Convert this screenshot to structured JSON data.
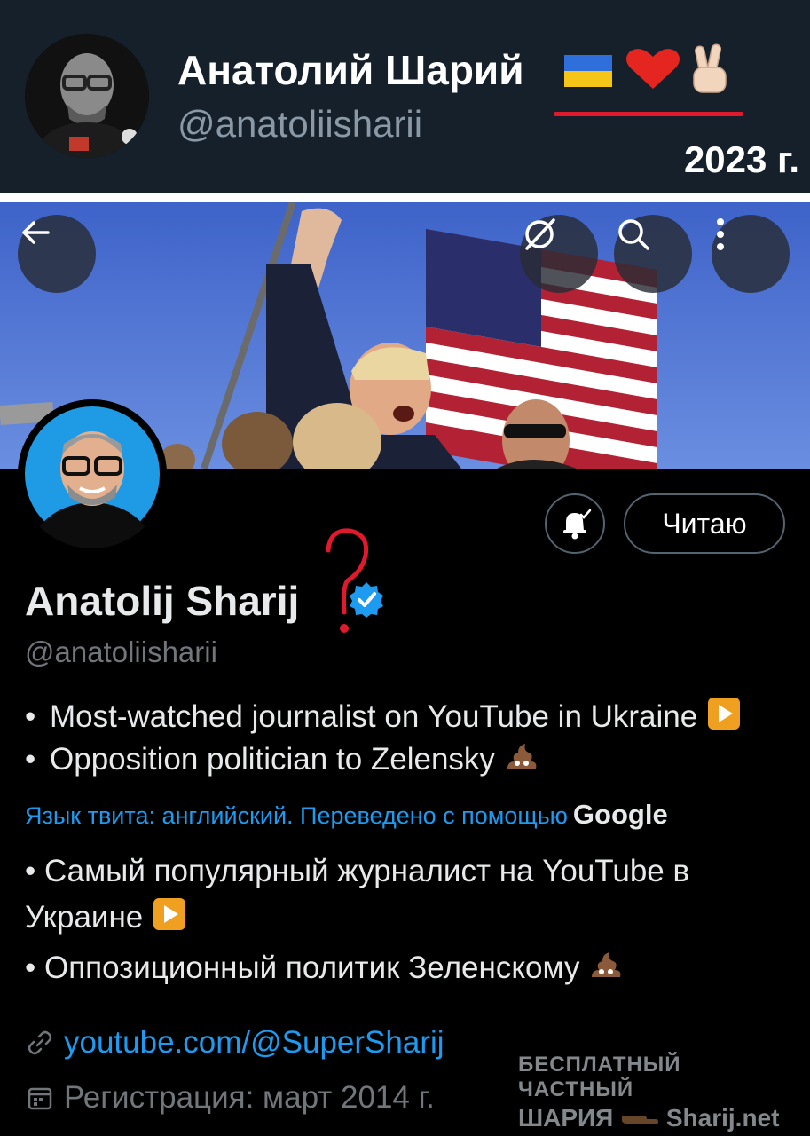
{
  "banner": {
    "name": "Анатолий Шарий",
    "handle": "@anatoliisharii",
    "year_label": "2023 г."
  },
  "header_buttons": [
    "back-arrow-icon",
    "grok-icon",
    "search-icon",
    "more-vertical-icon"
  ],
  "profile": {
    "display_name": "Anatolij Sharij",
    "handle": "@anatoliisharii",
    "follow_label": "Читаю",
    "bio": [
      "Most-watched journalist on YouTube in Ukraine",
      "Opposition politician to Zelensky"
    ],
    "translate_label": "Язык твита: английский. Переведено с помощью",
    "translate_brand": "Google",
    "translated_bio": [
      "• Самый популярный журналист на YouTube в Украине",
      "• Оппозиционный политик Зеленскому"
    ],
    "link": "youtube.com/@SuperSharij",
    "registration": "Регистрация: март 2014 г."
  },
  "watermark": {
    "line1": "БЕСПЛАТНЫЙ ЧАСТНЫЙ",
    "line2": "ШАРИЯ",
    "line2_site": "Sharij.net"
  },
  "colors": {
    "banner_bg": "#15202b",
    "link_blue": "#1d9bf0",
    "verified_blue": "#1d9bf0",
    "accent_red": "#e0192c"
  }
}
